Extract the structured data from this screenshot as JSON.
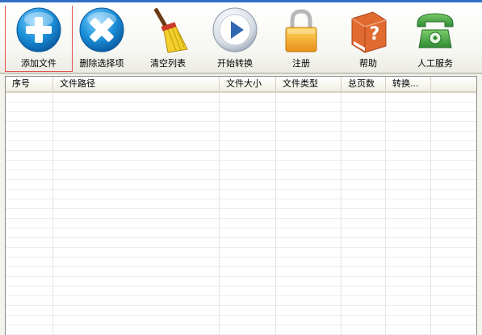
{
  "toolbar": {
    "items": [
      {
        "label": "添加文件",
        "icon": "add-icon",
        "color": "#1a8fd8"
      },
      {
        "label": "删除选择项",
        "icon": "delete-icon",
        "color": "#1a8fd8"
      },
      {
        "label": "清空列表",
        "icon": "broom-icon",
        "color": "#e8c21a"
      },
      {
        "label": "开始转换",
        "icon": "play-icon",
        "color": "#2f69b3"
      },
      {
        "label": "注册",
        "icon": "lock-icon",
        "color": "#f0a21e"
      },
      {
        "label": "帮助",
        "icon": "help-book-icon",
        "color": "#e06a30"
      },
      {
        "label": "人工服务",
        "icon": "phone-icon",
        "color": "#3c9a3c"
      }
    ]
  },
  "file_list": {
    "columns": [
      "序号",
      "文件路径",
      "文件大小",
      "文件类型",
      "总页数",
      "转换..."
    ],
    "rows": []
  }
}
